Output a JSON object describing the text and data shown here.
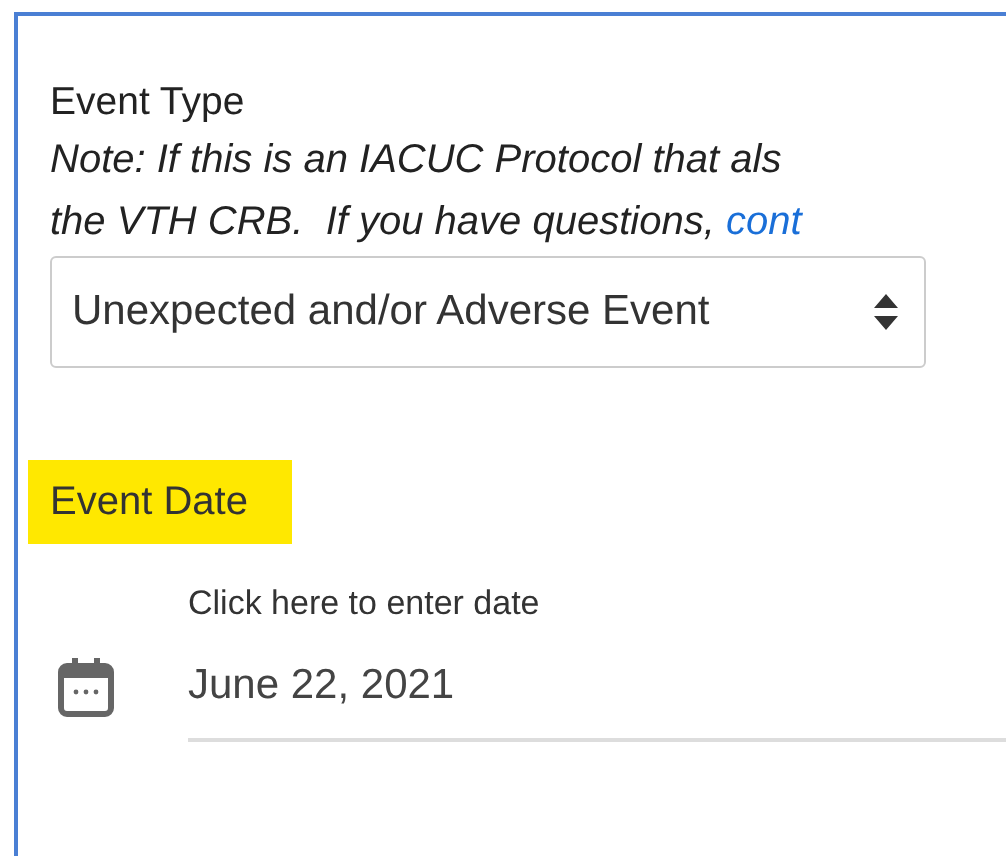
{
  "event_type": {
    "label": "Event Type",
    "note": {
      "lines": [
        "Note: If this is an IACUC Protocol that als",
        "the VTH CRB.  If you have questions, "
      ],
      "link": "cont"
    },
    "select": {
      "value": "Unexpected and/or Adverse Event"
    }
  },
  "event_date": {
    "label": "Event Date",
    "highlighted": true,
    "hint": "Click here to enter date",
    "value": "June 22, 2021"
  }
}
